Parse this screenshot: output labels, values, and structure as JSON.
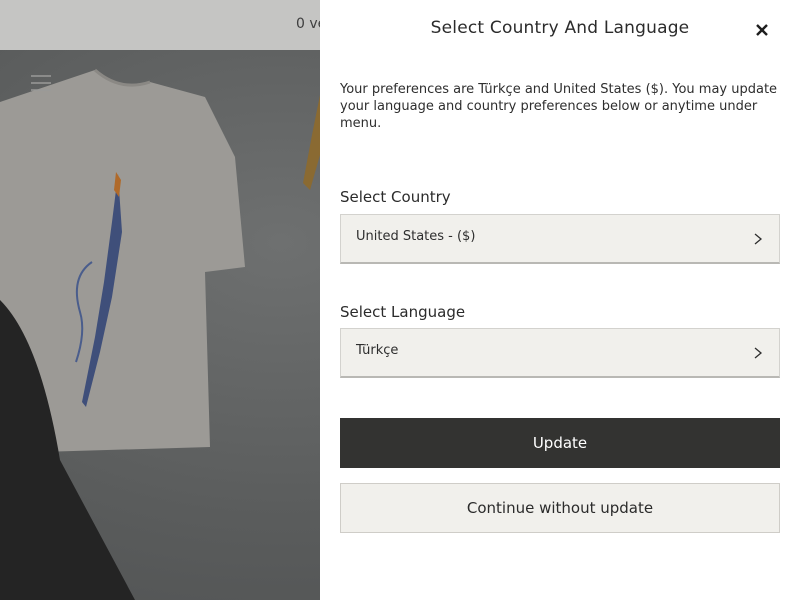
{
  "background": {
    "topbar_text": "0 ve",
    "menu_icon": "hamburger-menu-icon"
  },
  "modal": {
    "title": "Select Country And Language",
    "close_icon": "close-icon",
    "intro": "Your preferences are Türkçe and United States ($). You may update your language and country preferences below or anytime under menu.",
    "country": {
      "label": "Select Country",
      "value": "United States - ($)"
    },
    "language": {
      "label": "Select Language",
      "value": "Türkçe"
    },
    "update_label": "Update",
    "continue_label": "Continue without update"
  },
  "colors": {
    "primary_button": "#333331",
    "field_background": "#f1f0ec",
    "panel_background": "#ffffff",
    "overlay_topbar": "#c5c5c3"
  }
}
